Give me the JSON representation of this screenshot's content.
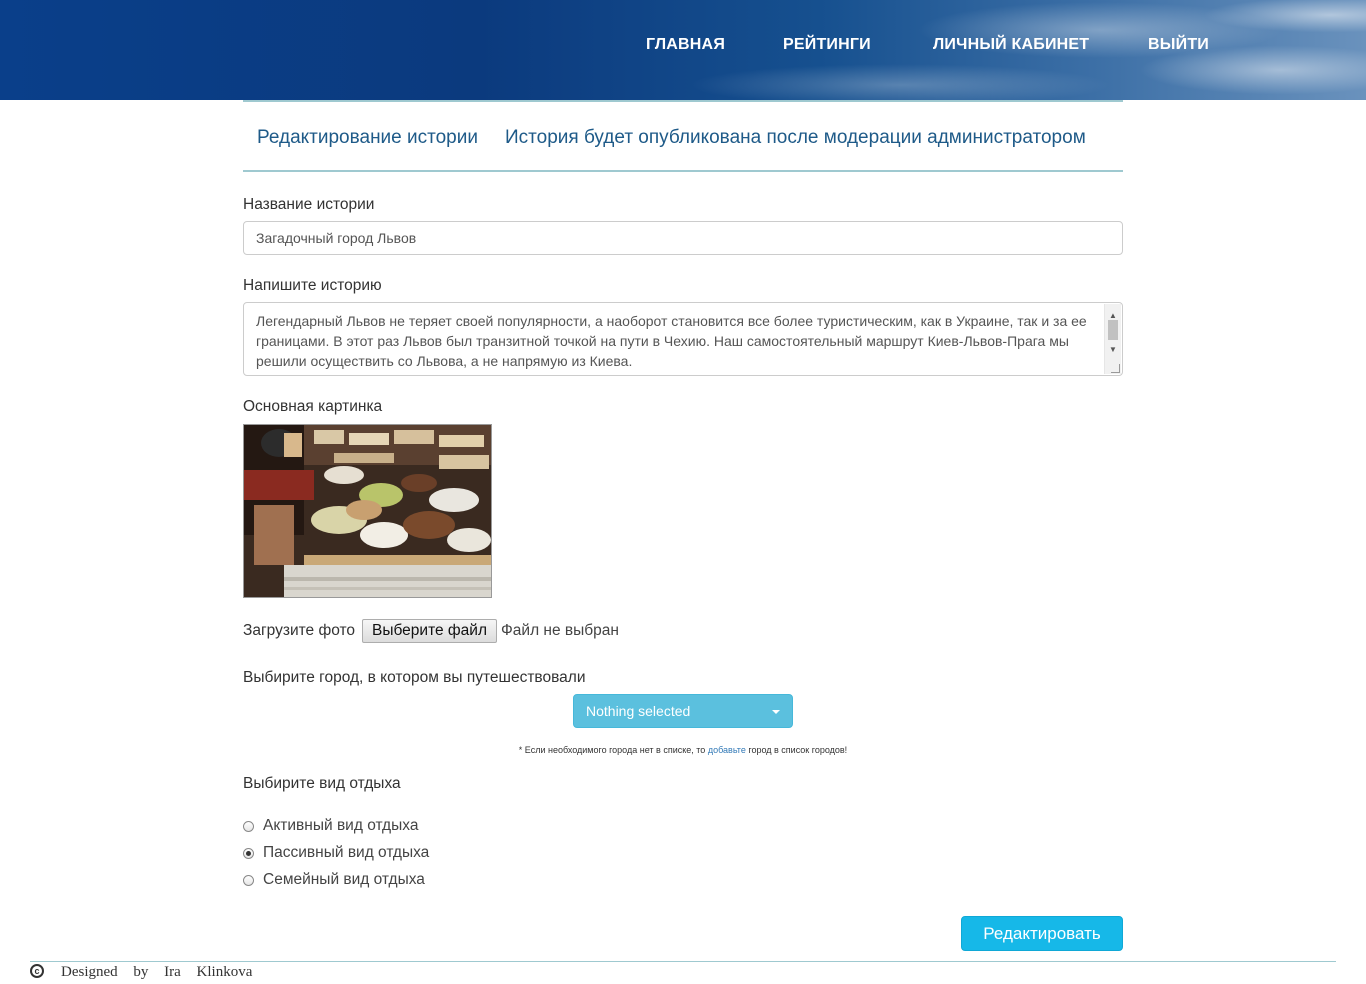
{
  "nav": {
    "home": "ГЛАВНАЯ",
    "ratings": "РЕЙТИНГИ",
    "account": "ЛИЧНЫЙ КАБИНЕТ",
    "logout": "ВЫЙТИ"
  },
  "tabs": {
    "edit": "Редактирование истории",
    "moderation": "История будет опубликована после модерации администратором"
  },
  "form": {
    "title_label": "Название истории",
    "title_value": "Загадочный город Львов",
    "story_label": "Напишите историю",
    "story_value": "Легендарный Львов не теряет своей популярности, а наоборот становится все более туристическим, как в Украине, так и за ее границами. В этот раз Львов был транзитной точкой на пути в Чехию. Наш самостоятельный маршрут Киев-Львов-Прага мы решили осуществить со Львова, а не напрямую из Киева.",
    "image_label": "Основная картинка",
    "upload_label": "Загрузите фото",
    "upload_button": "Выберите файл",
    "upload_status": "Файл не выбран",
    "city_label": "Выбирите город, в котором вы путешествовали",
    "city_select": "Nothing selected",
    "note_prefix": "* Если необходимого города нет в списке, то",
    "note_link": "добавьте",
    "note_suffix": "город в список городов!",
    "rest_label": "Выбирите вид отдыха",
    "rest_options": [
      {
        "label": "Активный вид отдыха",
        "checked": false
      },
      {
        "label": "Пассивный вид отдыха",
        "checked": true
      },
      {
        "label": "Семейный вид отдыха",
        "checked": false
      }
    ],
    "submit": "Редактировать"
  },
  "footer": {
    "copyright_symbol": "c",
    "text": "Designed by Ira Klinkova"
  },
  "colors": {
    "accent": "#16b8e8",
    "select": "#5bc0de",
    "tab_text": "#1e5a88",
    "divider": "#9fc9d0"
  }
}
